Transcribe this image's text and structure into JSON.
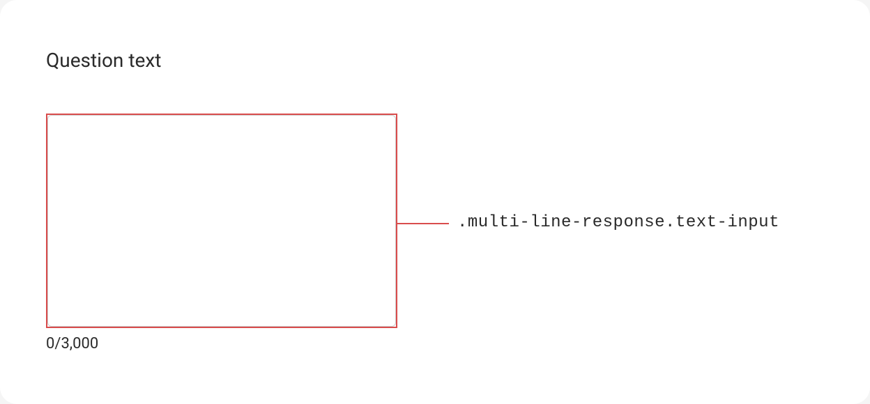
{
  "question": {
    "label": "Question text"
  },
  "textarea": {
    "value": "",
    "counter": "0/3,000"
  },
  "annotation": {
    "selector": ".multi-line-response.text-input"
  }
}
